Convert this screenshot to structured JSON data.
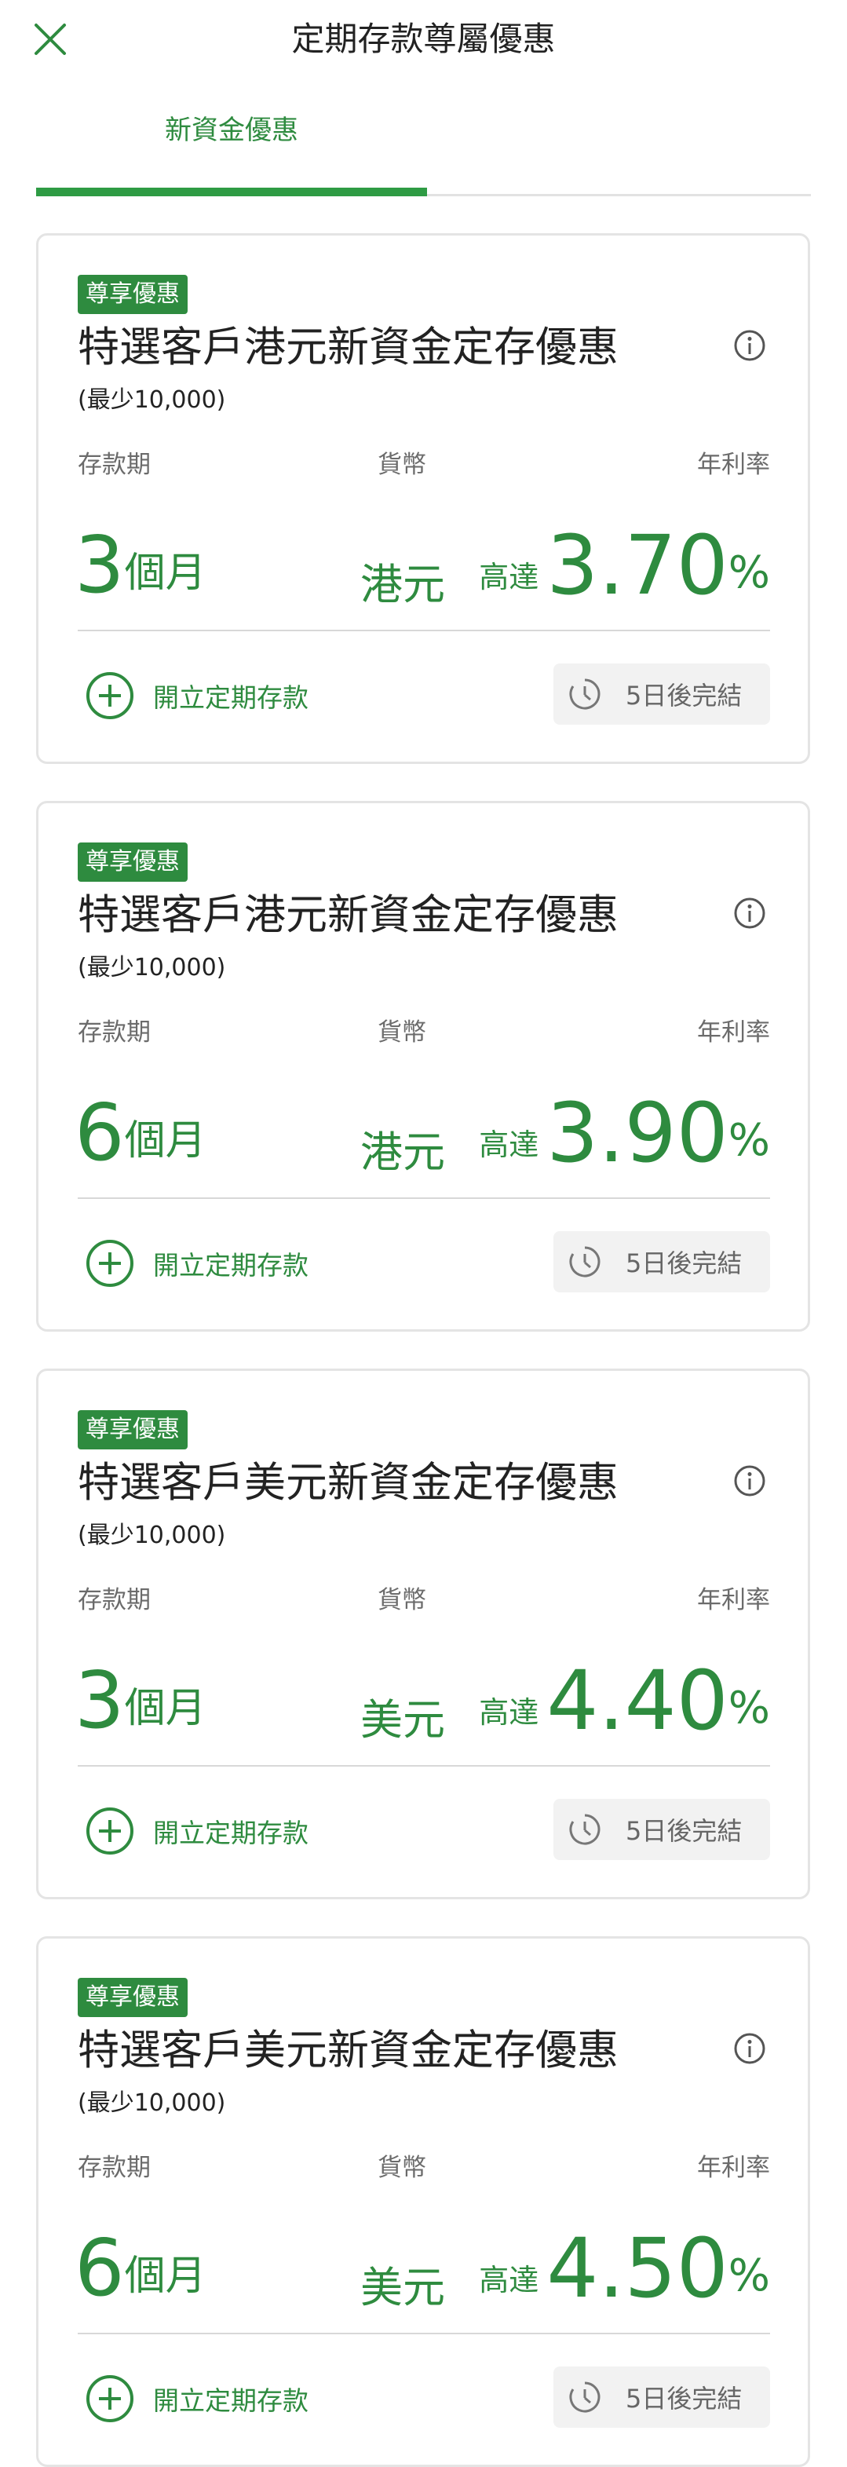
{
  "header": {
    "title": "定期存款尊屬優惠",
    "close_icon": "close-icon"
  },
  "tabs": [
    {
      "label": "新資金優惠",
      "active": true
    }
  ],
  "colors": {
    "accent": "#2e8b3f",
    "tab_underline": "#2e9b44"
  },
  "labels": {
    "term": "存款期",
    "currency": "貨幣",
    "rate": "年利率",
    "rate_prefix": "高達",
    "rate_unit": "%",
    "term_unit": "個月",
    "open_account": "開立定期存款",
    "expiry": "5日後完結"
  },
  "offers": [
    {
      "badge": "尊享優惠",
      "title": "特選客戶港元新資金定存優惠",
      "min_amount": "(最少10,000)",
      "term": "3",
      "currency": "港元",
      "rate": "3.70"
    },
    {
      "badge": "尊享優惠",
      "title": "特選客戶港元新資金定存優惠",
      "min_amount": "(最少10,000)",
      "term": "6",
      "currency": "港元",
      "rate": "3.90"
    },
    {
      "badge": "尊享優惠",
      "title": "特選客戶美元新資金定存優惠",
      "min_amount": "(最少10,000)",
      "term": "3",
      "currency": "美元",
      "rate": "4.40"
    },
    {
      "badge": "尊享優惠",
      "title": "特選客戶美元新資金定存優惠",
      "min_amount": "(最少10,000)",
      "term": "6",
      "currency": "美元",
      "rate": "4.50"
    }
  ]
}
